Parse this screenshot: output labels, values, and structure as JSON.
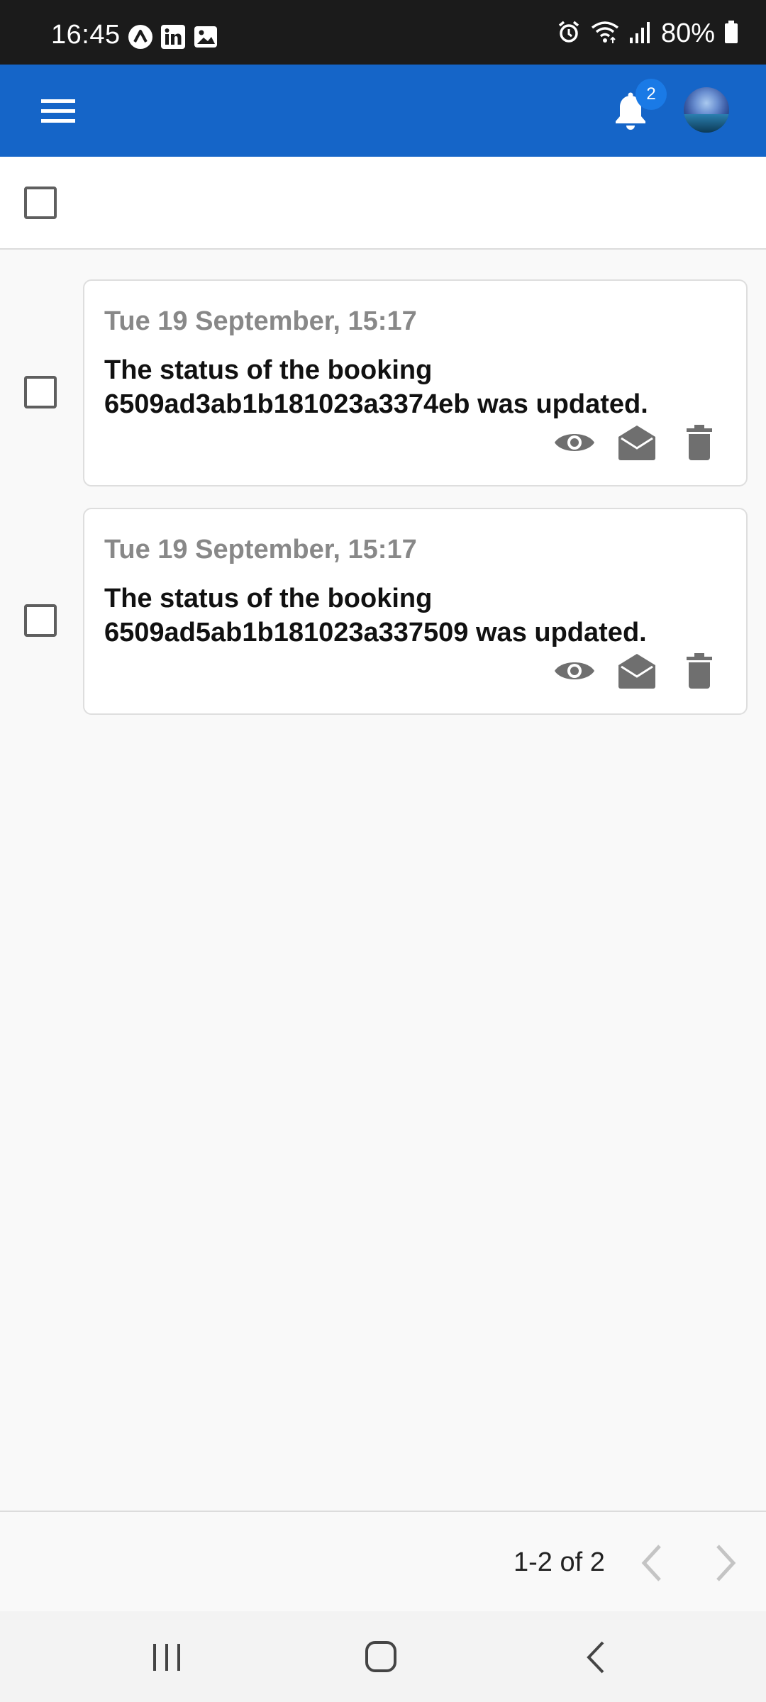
{
  "status_bar": {
    "time": "16:45",
    "battery": "80%",
    "left_icons": [
      "app-a-icon",
      "linkedin-icon",
      "gallery-icon"
    ],
    "right_icons": [
      "alarm-icon",
      "wifi-icon",
      "signal-icon",
      "battery-icon"
    ]
  },
  "app_bar": {
    "background_color": "#1565c8",
    "notification_count": "2"
  },
  "notifications": [
    {
      "date": "Tue 19 September, 15:17",
      "message": "The status of the booking 6509ad3ab1b181023a3374eb was updated."
    },
    {
      "date": "Tue 19 September, 15:17",
      "message": "The status of the booking 6509ad5ab1b181023a337509 was updated."
    }
  ],
  "pagination": {
    "info": "1-2 of 2"
  },
  "colors": {
    "text_muted": "#888888",
    "icon_gray": "#6f6f6f"
  }
}
